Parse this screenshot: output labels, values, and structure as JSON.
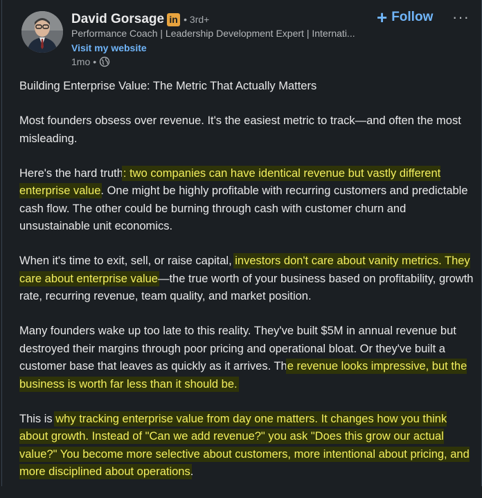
{
  "author": {
    "name": "David Gorsage",
    "badge": "in",
    "degree": "3rd+",
    "headline": "Performance Coach | Leadership Development Expert | Internati...",
    "website_label": "Visit my website",
    "time": "1mo",
    "visibility_icon": "globe-icon"
  },
  "actions": {
    "follow_plus": "+",
    "follow_label": "Follow",
    "more": "···"
  },
  "colors": {
    "background": "#1b1f23",
    "text": "#e9e9ea",
    "link": "#70b5f9",
    "highlight_bg": "#2f3409",
    "highlight_text": "#f3ef5e"
  },
  "post": {
    "title": "Building Enterprise Value: The Metric That Actually Matters",
    "p1": "Most founders obsess over revenue. It's the easiest metric to track—and often the most misleading.",
    "p2a": "Here's the hard truth",
    "p2b": ": two companies can have identical revenue but vastly different enterprise value",
    "p2c": ". One might be highly profitable with recurring customers and predictable cash flow. The other could be burning through cash with customer churn and unsustainable unit economics.",
    "p3a": "When it's time to exit, sell, or raise capital, ",
    "p3b": "investors don't care about vanity metrics. They care about enterprise value",
    "p3c": "—the true worth of your business based on profitability, growth rate, recurring revenue, team quality, and market position.",
    "p4a": "Many founders wake up too late to this reality. They've built $5M in annual revenue but destroyed their margins through poor pricing and operational bloat. Or they've built a customer base that leaves as quickly as it arrives. Th",
    "p4b": "e revenue looks impressive, but the business is worth far less than it should be.",
    "p5a": "This is ",
    "p5b": "why tracking enterprise value from day one matters. It changes how you think about growth. Instead of \"Can we add revenue?\" you ask \"Does this grow our actual value?\" You become more selective about customers, more intentional about pricing, and more disciplined about operations",
    "p5c": "."
  }
}
